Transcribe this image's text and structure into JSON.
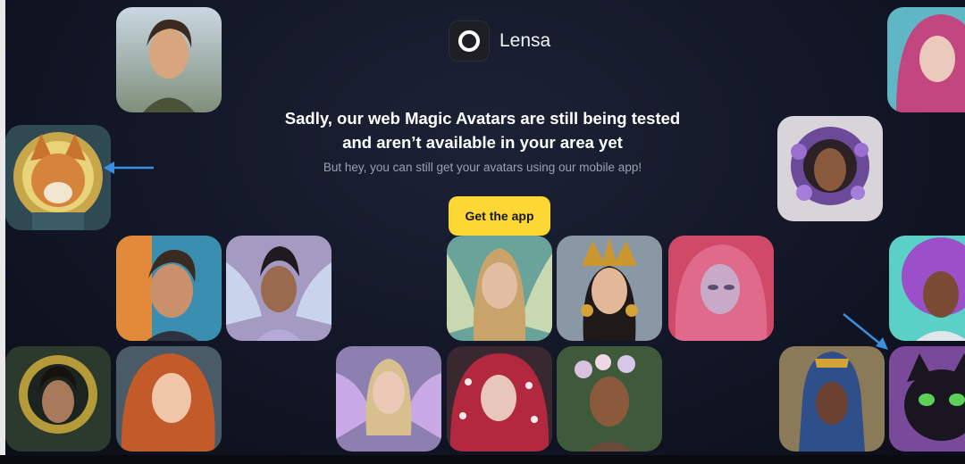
{
  "app": {
    "name": "Lensa"
  },
  "message": {
    "headline_line1": "Sadly, our web Magic Avatars are still being tested",
    "headline_line2": "and aren’t available in your area yet",
    "subtext": "But hey, you can still get your avatars using our mobile app!"
  },
  "cta": {
    "label": "Get the app"
  },
  "colors": {
    "accent": "#fdd835",
    "background": "#121626",
    "annotation_arrow": "#3b8fe0"
  },
  "avatars": [
    {
      "id": "avatar-warrior-man"
    },
    {
      "id": "avatar-shiba-astronaut"
    },
    {
      "id": "avatar-pink-hair-woman"
    },
    {
      "id": "avatar-flower-helmet-woman"
    },
    {
      "id": "avatar-young-man"
    },
    {
      "id": "avatar-fairy-woman"
    },
    {
      "id": "avatar-fairy-blonde"
    },
    {
      "id": "avatar-golden-crown-woman"
    },
    {
      "id": "avatar-chrome-face-woman"
    },
    {
      "id": "avatar-purple-afro-woman"
    },
    {
      "id": "avatar-golden-halo-woman"
    },
    {
      "id": "avatar-redhead-woman"
    },
    {
      "id": "avatar-butterfly-wings-woman"
    },
    {
      "id": "avatar-pearl-redhead"
    },
    {
      "id": "avatar-flower-crown-woman"
    },
    {
      "id": "avatar-pharaoh-man"
    },
    {
      "id": "avatar-black-cat"
    }
  ]
}
